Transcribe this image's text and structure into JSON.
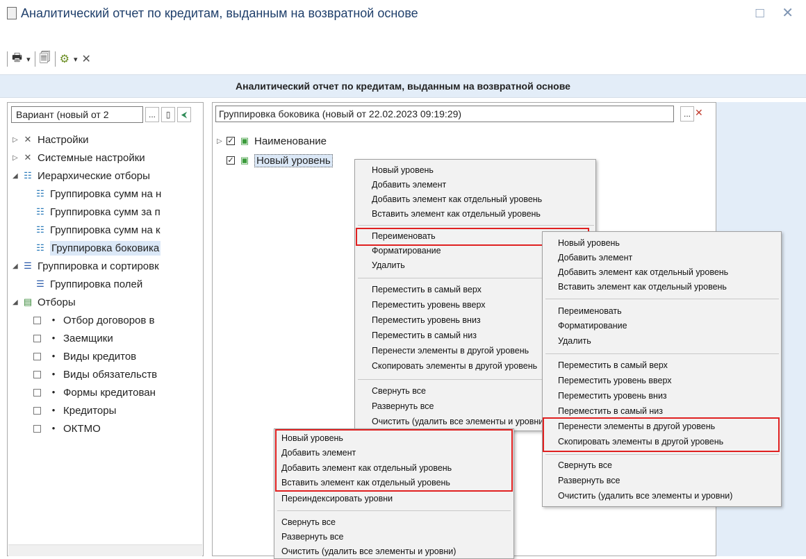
{
  "window": {
    "title": "Аналитический отчет по кредитам, выданным на возвратной основе",
    "controls": "□ ✕"
  },
  "toolbar": {
    "print_icon": "🖶",
    "dropdown": "▾",
    "preview_icon": "🗐",
    "settings_icon": "⚙",
    "tools_icon": "✕"
  },
  "report_header": "Аналитический отчет по кредитам, выданным на возвратной основе",
  "left_panel": {
    "variant_field": "Вариант (новый от 2",
    "tree": [
      "Настройки",
      "Системные настройки",
      "Иерархические отборы",
      "Группировка сумм на н",
      "Группировка сумм за п",
      "Группировка сумм на к",
      "Группировка боковика",
      "Группировка и сортировк",
      "Группировка полей",
      "Отборы",
      "Отбор договоров в",
      "Заемщики",
      "Виды кредитов",
      "Виды обязательств",
      "Формы кредитован",
      "Кредиторы",
      "ОКТМО"
    ]
  },
  "right_panel": {
    "header": "Группировка боковика (новый от 22.02.2023 09:19:29)",
    "items": [
      "Наименование",
      "Новый уровень"
    ]
  },
  "menu1": [
    "Новый уровень",
    "Добавить элемент",
    "Добавить элемент как отдельный уровень",
    "Вставить элемент как отдельный уровень",
    "Переименовать",
    "Форматирование",
    "Удалить",
    "Переместить в самый верх",
    "Переместить уровень вверх",
    "Переместить уровень вниз",
    "Переместить в самый низ",
    "Перенести элементы в другой уровень",
    "Скопировать элементы в другой уровень",
    "Свернуть все",
    "Развернуть все",
    "Очистить (удалить все элементы и уровни)"
  ],
  "menu2": [
    "Новый уровень",
    "Добавить элемент",
    "Добавить элемент как отдельный уровень",
    "Вставить элемент как отдельный уровень",
    "Переименовать",
    "Форматирование",
    "Удалить",
    "Переместить в самый верх",
    "Переместить уровень вверх",
    "Переместить уровень вниз",
    "Переместить в самый низ",
    "Перенести элементы в другой уровень",
    "Скопировать элементы в другой уровень",
    "Свернуть все",
    "Развернуть все",
    "Очистить (удалить все элементы и уровни)"
  ],
  "menu3": [
    "Новый уровень",
    "Добавить элемент",
    "Добавить элемент как отдельный уровень",
    "Вставить элемент как отдельный уровень",
    "Переиндексировать уровни",
    "Свернуть все",
    "Развернуть все",
    "Очистить (удалить все элементы и уровни)"
  ]
}
